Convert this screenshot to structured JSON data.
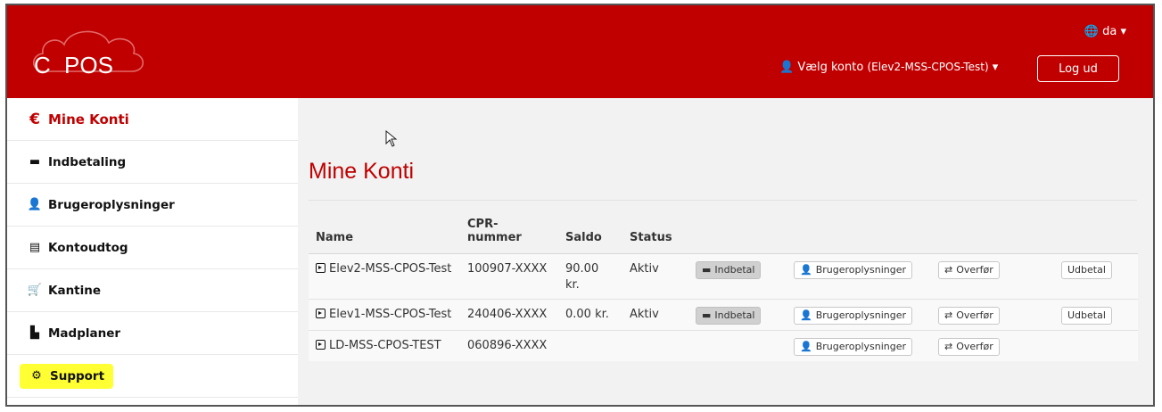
{
  "brand": {
    "logo_text_left": "C",
    "logo_text_right": "POS",
    "colors": {
      "primary": "#c00000",
      "highlight": "#ffff33"
    }
  },
  "header": {
    "language": "da",
    "account_label": "Vælg konto",
    "account_name": "(Elev2-MSS-CPOS-Test)",
    "logout": "Log ud"
  },
  "sidebar": {
    "items": [
      {
        "label": "Mine Konti",
        "icon": "euro-icon",
        "glyph": "€"
      },
      {
        "label": "Indbetaling",
        "icon": "credit-card-icon",
        "glyph": "▬"
      },
      {
        "label": "Brugeroplysninger",
        "icon": "user-icon",
        "glyph": "👤"
      },
      {
        "label": "Kontoudtog",
        "icon": "list-icon",
        "glyph": "▤"
      },
      {
        "label": "Kantine",
        "icon": "cart-icon",
        "glyph": "🛒"
      },
      {
        "label": "Madplaner",
        "icon": "file-icon",
        "glyph": "▙"
      },
      {
        "label": "Support",
        "icon": "gear-icon",
        "glyph": "⚙"
      }
    ]
  },
  "main": {
    "title": "Mine Konti",
    "table": {
      "headers": {
        "name": "Name",
        "cpr_1": "CPR-",
        "cpr_2": "nummer",
        "saldo": "Saldo",
        "status": "Status"
      },
      "rows": [
        {
          "name": "Elev2-MSS-CPOS-Test",
          "cpr": "100907-XXXX",
          "saldo": "90.00 kr.",
          "status": "Aktiv",
          "pay": "Indbetal",
          "info": "Brugeroplysninger",
          "transfer": "Overfør",
          "withdraw": "Udbetal"
        },
        {
          "name": "Elev1-MSS-CPOS-Test",
          "cpr": "240406-XXXX",
          "saldo": "0.00 kr.",
          "status": "Aktiv",
          "pay": "Indbetal",
          "info": "Brugeroplysninger",
          "transfer": "Overfør",
          "withdraw": "Udbetal"
        },
        {
          "name": "LD-MSS-CPOS-TEST",
          "cpr": "060896-XXXX",
          "saldo": "",
          "status": "",
          "info": "Brugeroplysninger",
          "transfer": "Overfør"
        }
      ]
    }
  }
}
